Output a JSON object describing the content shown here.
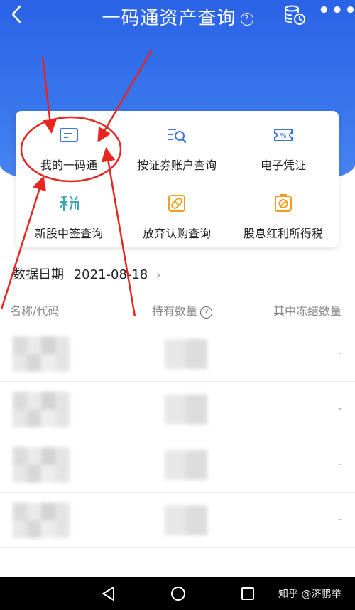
{
  "header": {
    "title": "一码通资产查询",
    "help_glyph": "?",
    "more_glyph": "•••",
    "back_icon": "chevron-left-icon",
    "records_icon": "database-clock-icon"
  },
  "services": [
    {
      "label": "我的一码通",
      "icon": "card-icon"
    },
    {
      "label": "按证券账户查询",
      "icon": "list-search-icon"
    },
    {
      "label": "电子凭证",
      "icon": "ticket-percent-icon"
    },
    {
      "label": "新股中签查询",
      "icon": "tax-char-icon"
    },
    {
      "label": "放弃认购查询",
      "icon": "pill-icon"
    },
    {
      "label": "股息红利所得税",
      "icon": "no-entry-icon"
    }
  ],
  "date": {
    "label": "数据日期",
    "value": "2021-08-18",
    "chevron": "›"
  },
  "table": {
    "columns": [
      "名称/代码",
      "持有数量",
      "其中冻结数量"
    ],
    "help_glyph": "?",
    "rows": [
      {
        "frozen": "-"
      },
      {
        "frozen": "-"
      },
      {
        "frozen": "-"
      },
      {
        "frozen": "-"
      }
    ]
  },
  "footer": {
    "watermark": "知乎 @济鹏举"
  },
  "colors": {
    "primary": "#2a63e6",
    "annotation": "#e8251f",
    "icon_blue": "#3d78d8",
    "icon_orange": "#f0a020"
  }
}
